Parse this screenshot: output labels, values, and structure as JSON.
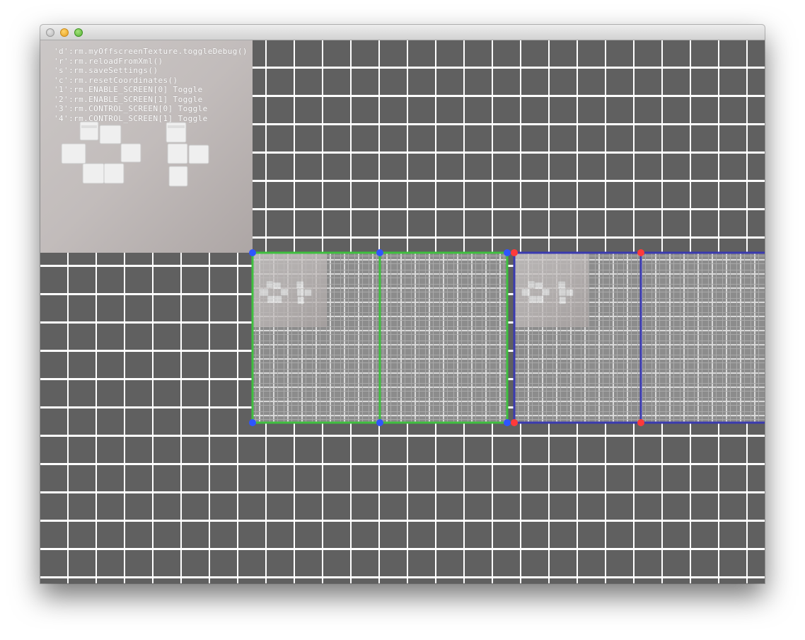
{
  "window": {
    "title": "",
    "traffic_lights": [
      "close",
      "minimize",
      "maximize"
    ]
  },
  "colors": {
    "background": "#606060",
    "grid": "#ffffff",
    "screen0_border": "#3fbf3f",
    "screen1_border": "#3a3ab0",
    "screen0_handles": "#2e55ff",
    "screen1_handles": "#ff3a3a"
  },
  "help_lines": [
    "'d':rm.myOffscreenTexture.toggleDebug()",
    "'r':rm.reloadFromXml()",
    "'s':rm.saveSettings()",
    "'c':rm.resetCoordinates()",
    "'1':rm.ENABLE_SCREEN[0] Toggle",
    "'2':rm.ENABLE_SCREEN[1] Toggle",
    "'3':rm.CONTROL_SCREEN[0] Toggle",
    "'4':rm.CONTROL_SCREEN[1] Toggle"
  ],
  "preview_image": {
    "icon": "of-logo-sugar-cubes",
    "letters": "OF"
  }
}
